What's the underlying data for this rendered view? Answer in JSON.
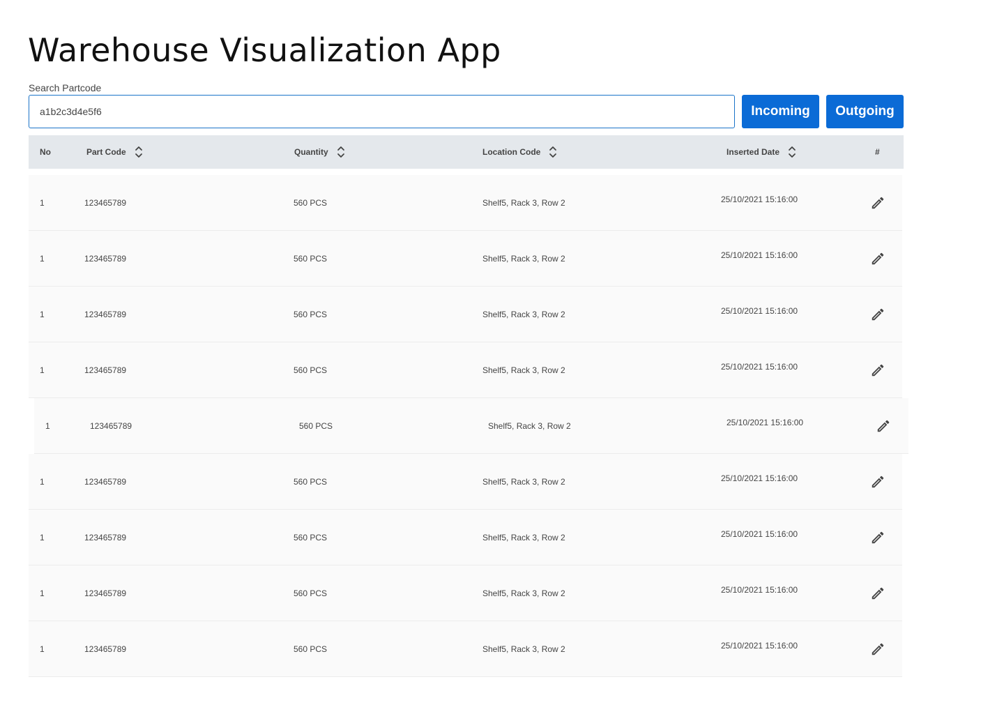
{
  "app": {
    "title": "Warehouse Visualization App"
  },
  "search": {
    "label": "Search Partcode",
    "value": "a1b2c3d4e5f6"
  },
  "actions": {
    "incoming_label": "Incoming",
    "outgoing_label": "Outgoing",
    "button_color": "#0b6bd6"
  },
  "table": {
    "columns": [
      {
        "label": "No",
        "sortable": false
      },
      {
        "label": "Part Code",
        "sortable": true
      },
      {
        "label": "Quantity",
        "sortable": true
      },
      {
        "label": "Location Code",
        "sortable": true
      },
      {
        "label": "Inserted Date",
        "sortable": true
      },
      {
        "label": "#",
        "sortable": false
      }
    ],
    "rows": [
      {
        "no": "1",
        "part_code": "123465789",
        "quantity": "560 PCS",
        "location": "Shelf5, Rack 3, Row 2",
        "inserted_date": "25/10/2021 15:16:00",
        "action_icon": "edit-icon"
      },
      {
        "no": "1",
        "part_code": "123465789",
        "quantity": "560 PCS",
        "location": "Shelf5, Rack 3, Row 2",
        "inserted_date": "25/10/2021 15:16:00",
        "action_icon": "edit-icon"
      },
      {
        "no": "1",
        "part_code": "123465789",
        "quantity": "560 PCS",
        "location": "Shelf5, Rack 3, Row 2",
        "inserted_date": "25/10/2021 15:16:00",
        "action_icon": "edit-icon"
      },
      {
        "no": "1",
        "part_code": "123465789",
        "quantity": "560 PCS",
        "location": "Shelf5, Rack 3, Row 2",
        "inserted_date": "25/10/2021 15:16:00",
        "action_icon": "edit-icon"
      },
      {
        "no": "1",
        "part_code": "123465789",
        "quantity": "560 PCS",
        "location": "Shelf5, Rack 3, Row 2",
        "inserted_date": "25/10/2021 15:16:00",
        "action_icon": "edit-icon"
      },
      {
        "no": "1",
        "part_code": "123465789",
        "quantity": "560 PCS",
        "location": "Shelf5, Rack 3, Row 2",
        "inserted_date": "25/10/2021 15:16:00",
        "action_icon": "edit-icon"
      },
      {
        "no": "1",
        "part_code": "123465789",
        "quantity": "560 PCS",
        "location": "Shelf5, Rack 3, Row 2",
        "inserted_date": "25/10/2021 15:16:00",
        "action_icon": "edit-icon"
      },
      {
        "no": "1",
        "part_code": "123465789",
        "quantity": "560 PCS",
        "location": "Shelf5, Rack 3, Row 2",
        "inserted_date": "25/10/2021 15:16:00",
        "action_icon": "edit-icon"
      },
      {
        "no": "1",
        "part_code": "123465789",
        "quantity": "560 PCS",
        "location": "Shelf5, Rack 3, Row 2",
        "inserted_date": "25/10/2021 15:16:00",
        "action_icon": "edit-icon"
      }
    ]
  }
}
